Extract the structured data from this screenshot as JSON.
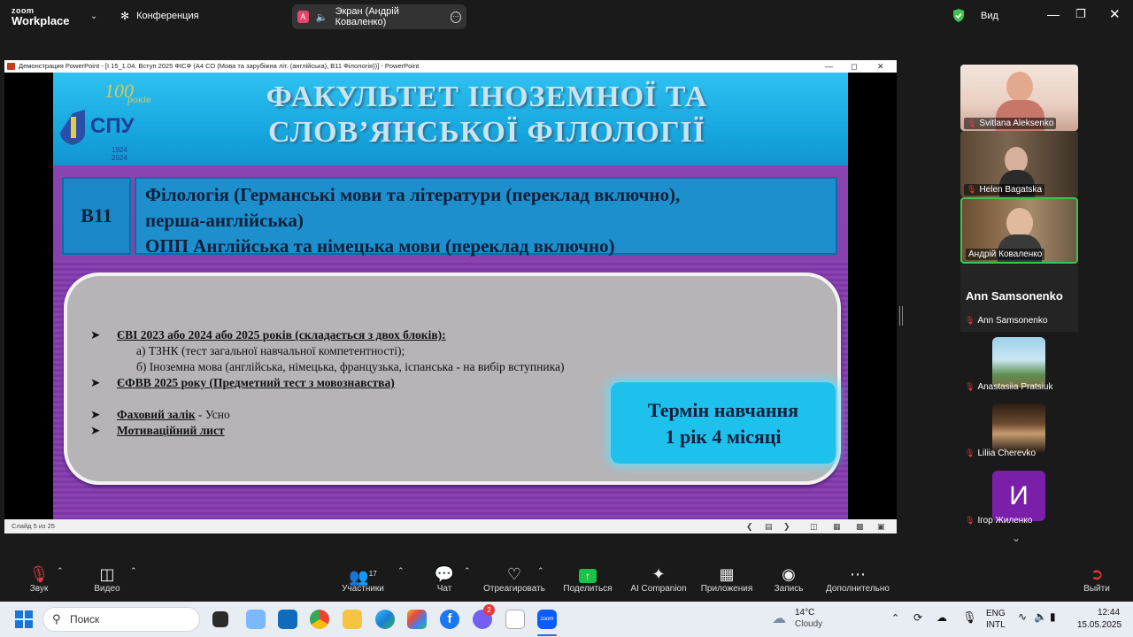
{
  "zoom": {
    "logo_top": "zoom",
    "logo_bottom": "Workplace",
    "meeting_label": "Конференция",
    "share_label": "Экран (Андрій Коваленко)",
    "share_avatar_letter": "A",
    "view_label": "Вид"
  },
  "window": {
    "title": "Демонстрация PowerPoint - [І 15_1.04. Вступ 2025 ФІСФ (А4 СО (Мова та зарубіжна літ. (англійська), В11 Філологія))] - PowerPoint",
    "status": "Слайд 5 из 25"
  },
  "slide": {
    "header_line1": "ФАКУЛЬТЕТ ІНОЗЕМНОЇ ТА",
    "header_line2": "СЛОВ’ЯНСЬКОЇ ФІЛОЛОГІЇ",
    "logo_number": "100",
    "logo_word": "років",
    "logo_abbr": "СПУ",
    "logo_years_1": "1924",
    "logo_years_2": "2024",
    "code": "В11",
    "program_line1": "Філологія (Германські мови та літератури (переклад включно),",
    "program_line2": "перша-англійська)",
    "program_line3": "ОПП Англійська та німецька мови (переклад включно)",
    "req1_title": "ЄВІ 2023 або 2024 або 2025 років (складається з двох блоків):",
    "req1_sub_a": "а) ТЗНК (тест загальної навчальної компетентності);",
    "req1_sub_b": "б) Іноземна мова (англійська, німецька, французька, іспанська - на вибір вступника)",
    "req2_title": "ЄФВВ 2025 року (Предметний тест з мовознавства)",
    "req3_title": "Фаховий залік",
    "req3_suffix": " - Усно",
    "req4_title": "Мотиваційний лист",
    "term_line1": "Термін навчання",
    "term_line2": "1 рік 4 місяці"
  },
  "participants": {
    "p1": "Svitlana Aleksenko",
    "p2": "Helen Bagatska",
    "p3": "Андрій Коваленко",
    "p4_big": "Ann Samsonenko",
    "p4": "Ann Samsonenko",
    "p5": "Anastasiia Pratsiuk",
    "p6": "Liliia Cherevko",
    "p7_letter": "И",
    "p7": "Ігор Жиленко"
  },
  "toolbar": {
    "audio": "Звук",
    "video": "Видео",
    "participants": "Участники",
    "participants_count": "17",
    "chat": "Чат",
    "react": "Отреагировать",
    "share": "Поделиться",
    "ai": "AI Companion",
    "apps": "Приложения",
    "record": "Запись",
    "more": "Дополнительно",
    "leave": "Выйти"
  },
  "taskbar": {
    "search": "Поиск",
    "weather_temp": "14°C",
    "weather_desc": "Cloudy",
    "lang1": "ENG",
    "lang2": "INTL",
    "time": "12:44",
    "date": "15.05.2025",
    "badge": "2",
    "zoom_icon_text": "zoom"
  },
  "colors": {
    "slide_purple": "#8f47b6",
    "header_blue": "#18a8e0",
    "term_cyan": "#1ec1ec",
    "speaker_green": "#3ec34d",
    "mic_red": "#e5393a"
  }
}
